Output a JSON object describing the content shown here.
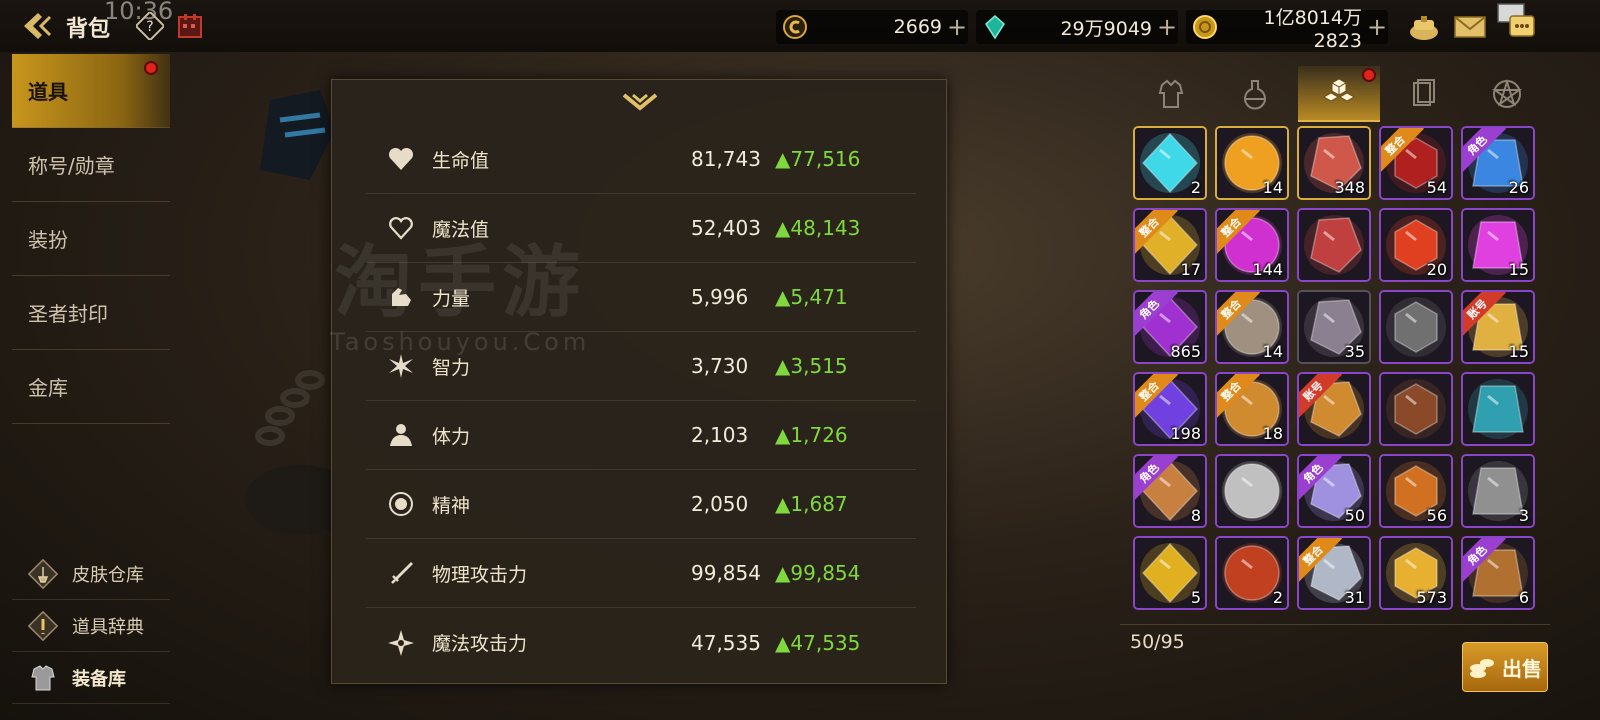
{
  "status_bar": {
    "time": "10:36"
  },
  "header": {
    "title": "背包"
  },
  "currencies": [
    {
      "name": "coin-c",
      "value": "2669"
    },
    {
      "name": "crystal",
      "value": "29万9049"
    },
    {
      "name": "gold",
      "value": "1亿8014万2823"
    }
  ],
  "nav": {
    "items": [
      {
        "label": "道具",
        "active": true,
        "badge": true
      },
      {
        "label": "称号/勋章"
      },
      {
        "label": "装扮"
      },
      {
        "label": "圣者封印"
      },
      {
        "label": "金库"
      }
    ],
    "side_links": [
      {
        "label": "皮肤仓库"
      },
      {
        "label": "道具辞典"
      },
      {
        "label": "装备库"
      }
    ]
  },
  "stats": {
    "rows": [
      {
        "name": "生命值",
        "value": "81,743",
        "increase": "▲77,516",
        "icon": "heart-filled-icon"
      },
      {
        "name": "魔法值",
        "value": "52,403",
        "increase": "▲48,143",
        "icon": "heart-outline-icon"
      },
      {
        "name": "力量",
        "value": "5,996",
        "increase": "▲5,471",
        "icon": "strength-arm-icon"
      },
      {
        "name": "智力",
        "value": "3,730",
        "increase": "▲3,515",
        "icon": "intelligence-burst-icon"
      },
      {
        "name": "体力",
        "value": "2,103",
        "increase": "▲1,726",
        "icon": "body-icon"
      },
      {
        "name": "精神",
        "value": "2,050",
        "increase": "▲1,687",
        "icon": "spirit-orb-icon"
      },
      {
        "name": "物理攻击力",
        "value": "99,854",
        "increase": "▲99,854",
        "icon": "sword-icon"
      },
      {
        "name": "魔法攻击力",
        "value": "47,535",
        "increase": "▲47,535",
        "icon": "magic-star-icon"
      }
    ],
    "watermark_cn": "淘手游",
    "watermark_en": "Taoshouyou.Com"
  },
  "inventory": {
    "tabs": [
      "armor-tab",
      "potion-tab",
      "materials-tab",
      "cards-tab",
      "emblem-tab"
    ],
    "active_tab": 2,
    "items": [
      {
        "qty": "2",
        "color": "#3fd8e8",
        "frame": "gold"
      },
      {
        "qty": "14",
        "color": "#f0a020",
        "frame": "gold"
      },
      {
        "qty": "348",
        "color": "#d0584a",
        "frame": "gold"
      },
      {
        "qty": "54",
        "color": "#b0201f",
        "frame": "purple",
        "ribbon": "整合",
        "ribbon_color": "orange"
      },
      {
        "qty": "26",
        "color": "#3a86e0",
        "frame": "purple",
        "ribbon": "角色",
        "ribbon_color": "purple"
      },
      {
        "qty": "17",
        "color": "#e0b028",
        "frame": "purple",
        "ribbon": "整合",
        "ribbon_color": "orange"
      },
      {
        "qty": "144",
        "color": "#d030d0",
        "frame": "purple",
        "ribbon": "整合",
        "ribbon_color": "orange"
      },
      {
        "qty": "",
        "color": "#c04040",
        "frame": "purple"
      },
      {
        "qty": "20",
        "color": "#e04020",
        "frame": "purple"
      },
      {
        "qty": "15",
        "color": "#e040e0",
        "frame": "purple"
      },
      {
        "qty": "865",
        "color": "#a030d0",
        "frame": "purple",
        "ribbon": "角色",
        "ribbon_color": "purple"
      },
      {
        "qty": "14",
        "color": "#a09080",
        "frame": "purple",
        "ribbon": "整合",
        "ribbon_color": "orange"
      },
      {
        "qty": "35",
        "color": "#8a8090",
        "frame": "plain"
      },
      {
        "qty": "",
        "color": "#707070",
        "frame": "purple"
      },
      {
        "qty": "15",
        "color": "#e0b040",
        "frame": "purple",
        "ribbon": "账号",
        "ribbon_color": "red"
      },
      {
        "qty": "198",
        "color": "#7040e0",
        "frame": "purple",
        "ribbon": "整合",
        "ribbon_color": "orange"
      },
      {
        "qty": "18",
        "color": "#d08a30",
        "frame": "purple",
        "ribbon": "整合",
        "ribbon_color": "orange"
      },
      {
        "qty": "",
        "color": "#d08a30",
        "frame": "purple",
        "ribbon": "账号",
        "ribbon_color": "red"
      },
      {
        "qty": "",
        "color": "#8a4a2a",
        "frame": "purple"
      },
      {
        "qty": "",
        "color": "#30a0b0",
        "frame": "purple"
      },
      {
        "qty": "8",
        "color": "#c88040",
        "frame": "purple",
        "ribbon": "角色",
        "ribbon_color": "purple"
      },
      {
        "qty": "",
        "color": "#c0c0c0",
        "frame": "purple"
      },
      {
        "qty": "50",
        "color": "#a090e0",
        "frame": "purple",
        "ribbon": "角色",
        "ribbon_color": "purple"
      },
      {
        "qty": "56",
        "color": "#d07020",
        "frame": "purple"
      },
      {
        "qty": "3",
        "color": "#909090",
        "frame": "purple"
      },
      {
        "qty": "5",
        "color": "#e0b020",
        "frame": "purple"
      },
      {
        "qty": "2",
        "color": "#c04020",
        "frame": "purple"
      },
      {
        "qty": "31",
        "color": "#b0b8c8",
        "frame": "purple",
        "ribbon": "整合",
        "ribbon_color": "orange"
      },
      {
        "qty": "573",
        "color": "#e8b030",
        "frame": "purple"
      },
      {
        "qty": "6",
        "color": "#b07030",
        "frame": "purple",
        "ribbon": "角色",
        "ribbon_color": "purple"
      }
    ],
    "capacity": "50/95",
    "sell_label": "出售"
  },
  "colors": {
    "accent_gold": "#c8961c",
    "increase_green": "#7fd93e",
    "badge_red": "#e2231a"
  }
}
